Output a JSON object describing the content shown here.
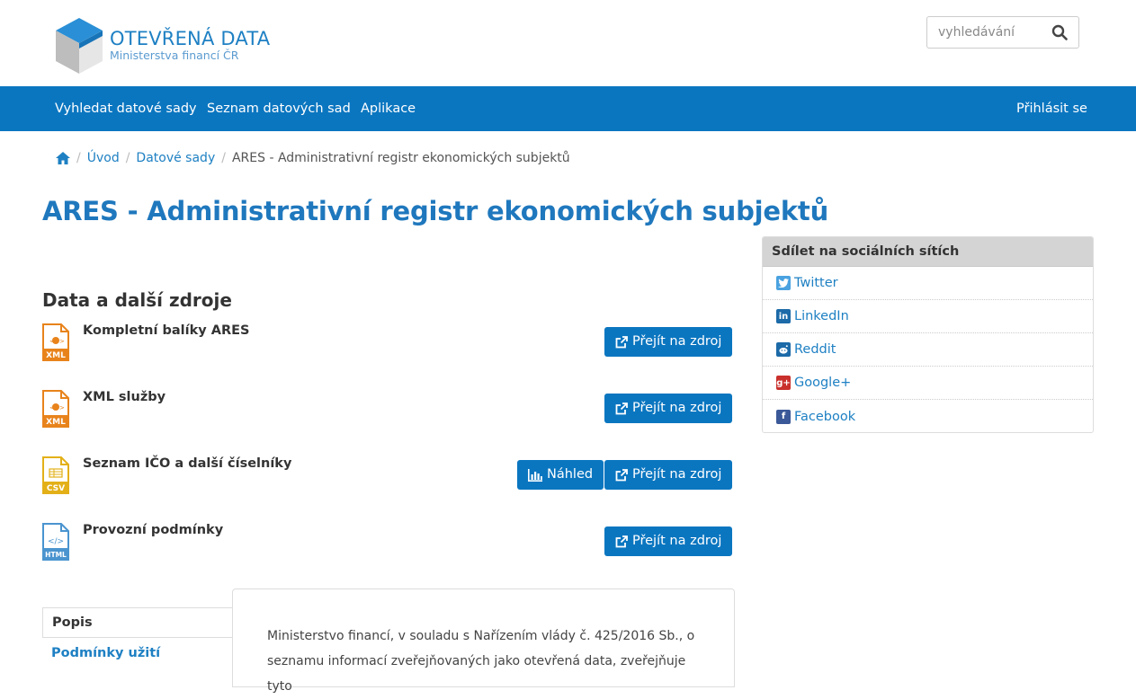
{
  "header": {
    "logo_title": "OTEVŘENÁ DATA",
    "logo_subtitle": "Ministerstva financí ČR",
    "search_placeholder": "vyhledávání"
  },
  "nav": {
    "items": [
      "Vyhledat datové sady",
      "Seznam datových sad",
      "Aplikace"
    ],
    "login": "Přihlásit se"
  },
  "breadcrumb": {
    "items": [
      "Úvod",
      "Datové sady"
    ],
    "current": "ARES - Administrativní registr ekonomických subjektů"
  },
  "page_title": "ARES - Administrativní registr ekonomických subjektů",
  "resources": {
    "section_title": "Data a další zdroje",
    "items": [
      {
        "name": "Kompletní balíky ARES",
        "format": "XML",
        "preview": "",
        "goto": "Přejít na zdroj"
      },
      {
        "name": "XML služby",
        "format": "XML",
        "preview": "",
        "goto": "Přejít na zdroj"
      },
      {
        "name": "Seznam IČO a další číselníky",
        "format": "CSV",
        "preview": "Náhled",
        "goto": "Přejít na zdroj"
      },
      {
        "name": "Provozní podmínky",
        "format": "HTML",
        "preview": "",
        "goto": "Přejít na zdroj"
      }
    ]
  },
  "share": {
    "title": "Sdílet na sociálních sítích",
    "items": [
      {
        "label": "Twitter",
        "icon": "twitter-icon",
        "color": "#4aa2e0"
      },
      {
        "label": "LinkedIn",
        "icon": "linkedin-icon",
        "color": "#1c6aa8"
      },
      {
        "label": "Reddit",
        "icon": "reddit-icon",
        "color": "#1c6aa8"
      },
      {
        "label": "Google+",
        "icon": "google-plus-icon",
        "color": "#c9302c"
      },
      {
        "label": "Facebook",
        "icon": "facebook-icon",
        "color": "#3b5998"
      }
    ]
  },
  "tabs": {
    "active": "Popis",
    "items": [
      "Podmínky užití"
    ]
  },
  "description": "Ministerstvo financí, v souladu s Nařízením vlády č. 425/2016 Sb., o seznamu informací zveřejňovaných jako otevřená data, zveřejňuje tyto"
}
